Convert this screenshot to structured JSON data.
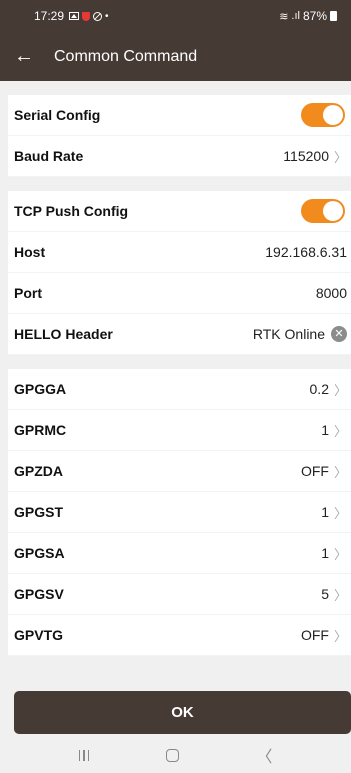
{
  "status_bar": {
    "time": "17:29",
    "battery": "87%",
    "icons": [
      "gallery-icon",
      "shield-icon",
      "blocked-icon",
      "dot-icon",
      "wifi-icon",
      "signal-icon",
      "battery-icon"
    ]
  },
  "app_bar": {
    "title": "Common Command",
    "back_icon": "←"
  },
  "serial": {
    "config_label": "Serial Config",
    "config_enabled": true,
    "baud_label": "Baud Rate",
    "baud_value": "115200"
  },
  "tcp": {
    "config_label": "TCP Push Config",
    "config_enabled": true,
    "host_label": "Host",
    "host_value": "192.168.6.31",
    "port_label": "Port",
    "port_value": "8000",
    "hello_label": "HELLO Header",
    "hello_value": "RTK Online"
  },
  "nmea": [
    {
      "label": "GPGGA",
      "value": "0.2"
    },
    {
      "label": "GPRMC",
      "value": "1"
    },
    {
      "label": "GPZDA",
      "value": "OFF"
    },
    {
      "label": "GPGST",
      "value": "1"
    },
    {
      "label": "GPGSA",
      "value": "1"
    },
    {
      "label": "GPGSV",
      "value": "5"
    },
    {
      "label": "GPVTG",
      "value": "OFF"
    }
  ],
  "ok_label": "OK",
  "colors": {
    "bar": "#453a34",
    "accent": "#f18b1d"
  }
}
